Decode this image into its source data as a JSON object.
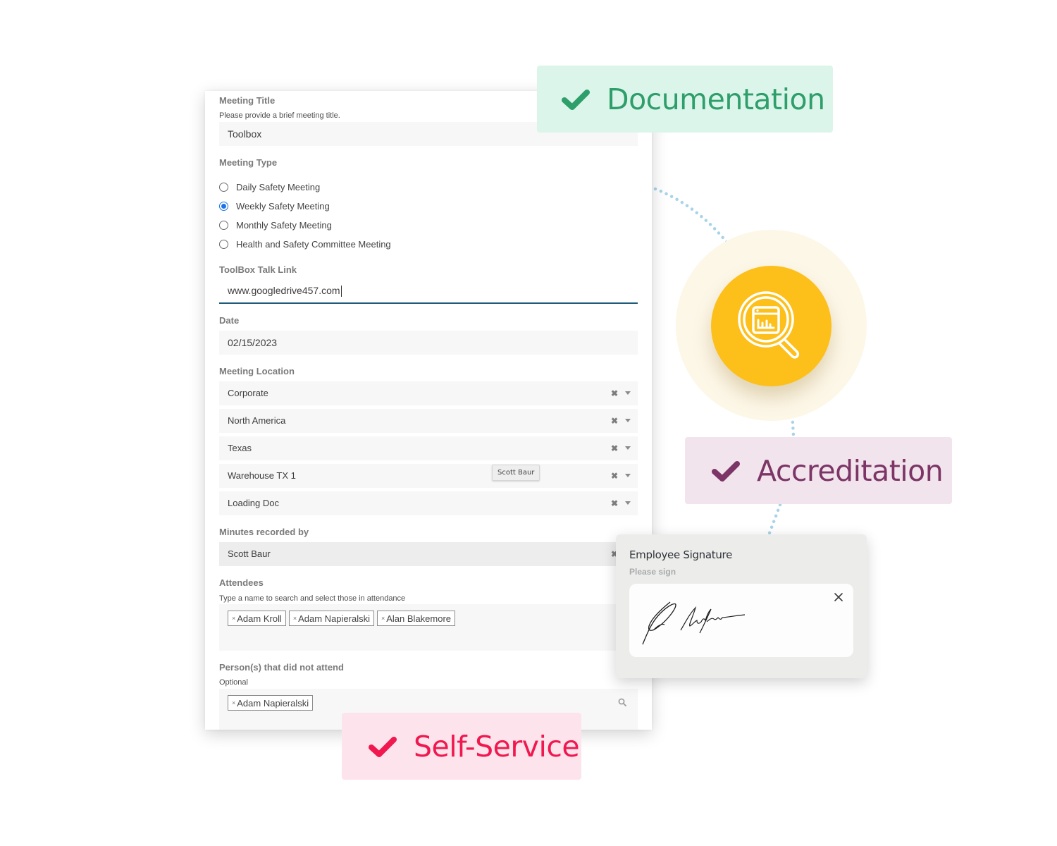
{
  "form": {
    "meeting_title": {
      "label": "Meeting Title",
      "hint": "Please provide a brief meeting title.",
      "value": "Toolbox"
    },
    "meeting_type": {
      "label": "Meeting Type",
      "options": [
        {
          "label": "Daily Safety Meeting",
          "checked": false
        },
        {
          "label": "Weekly Safety Meeting",
          "checked": true
        },
        {
          "label": "Monthly Safety Meeting",
          "checked": false
        },
        {
          "label": "Health and Safety Committee Meeting",
          "checked": false
        }
      ]
    },
    "toolbox_link": {
      "label": "ToolBox Talk Link",
      "value": "www.googledrive457.com"
    },
    "date": {
      "label": "Date",
      "value": "02/15/2023"
    },
    "meeting_location": {
      "label": "Meeting Location",
      "levels": [
        "Corporate",
        "North America",
        "Texas",
        "Warehouse TX 1",
        "Loading Doc"
      ],
      "clear_icon": "x-icon",
      "dropdown_icon": "caret-down-icon"
    },
    "tooltip": "Scott Baur",
    "minutes_recorded_by": {
      "label": "Minutes recorded by",
      "value": "Scott Baur"
    },
    "attendees": {
      "label": "Attendees",
      "hint": "Type a name to search and select those in attendance",
      "tags": [
        "Adam Kroll",
        "Adam Napieralski",
        "Alan Blakemore"
      ]
    },
    "not_attended": {
      "label": "Person(s) that did not attend",
      "hint": "Optional",
      "tags": [
        "Adam Napieralski"
      ],
      "search_icon": "search-icon"
    }
  },
  "badges": {
    "documentation": {
      "label": "Documentation",
      "icon": "check-icon",
      "color": "#2e9e6b",
      "bg": "#dcf5ea"
    },
    "accreditation": {
      "label": "Accreditation",
      "icon": "check-icon",
      "color": "#7c3566",
      "bg": "#f1e4ec"
    },
    "self_service": {
      "label": "Self-Service",
      "icon": "check-icon",
      "color": "#f0184f",
      "bg": "#fde4ec"
    }
  },
  "center_icon": {
    "icon": "magnifier-report-icon",
    "color": "#fdbf1a"
  },
  "signature": {
    "title": "Employee Signature",
    "subtitle": "Please sign",
    "close_icon": "close-icon"
  },
  "colors": {
    "focus_underline": "#1e5d7a",
    "radio_checked": "#1a73e8",
    "connector_dots": "#a9d3e8"
  }
}
